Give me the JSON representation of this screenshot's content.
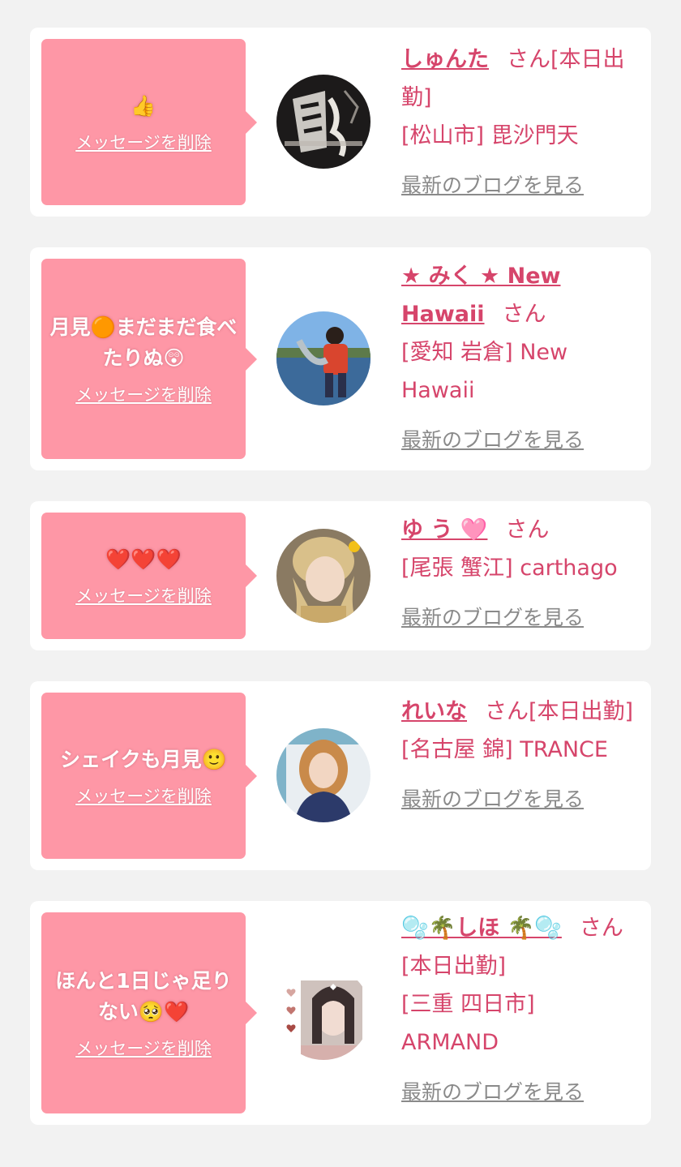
{
  "delete_label": "メッセージを削除",
  "blog_label": "最新のブログを見る",
  "san": "さん",
  "messages": [
    {
      "message": "👍",
      "name": "しゅんた",
      "suffix": "さん[本日出勤]",
      "shop": "[松山市] 毘沙門天"
    },
    {
      "message": "月見🟠まだまだ食べたりぬ😲",
      "name": "★ みく ★ New Hawaii",
      "suffix": "さん",
      "shop": "[愛知 岩倉] New Hawaii"
    },
    {
      "message": "❤️❤️❤️",
      "name": "ゆ う 🩷",
      "suffix": "さん",
      "shop": "[尾張 蟹江] carthago"
    },
    {
      "message": "シェイクも月見🙂",
      "name": "れいな",
      "suffix": "さん[本日出勤]",
      "shop": "[名古屋 錦] TRANCE"
    },
    {
      "message": "ほんと1日じゃ足りない🥺❤️",
      "name": "🫧🌴しほ 🌴🫧",
      "suffix": "さん[本日出勤]",
      "shop": "[三重 四日市] ARMAND"
    }
  ],
  "colors": {
    "background": "#f2f2f2",
    "bubble": "#fe97a6",
    "accent": "#d6456b",
    "link_gray": "#8a8a8a"
  }
}
